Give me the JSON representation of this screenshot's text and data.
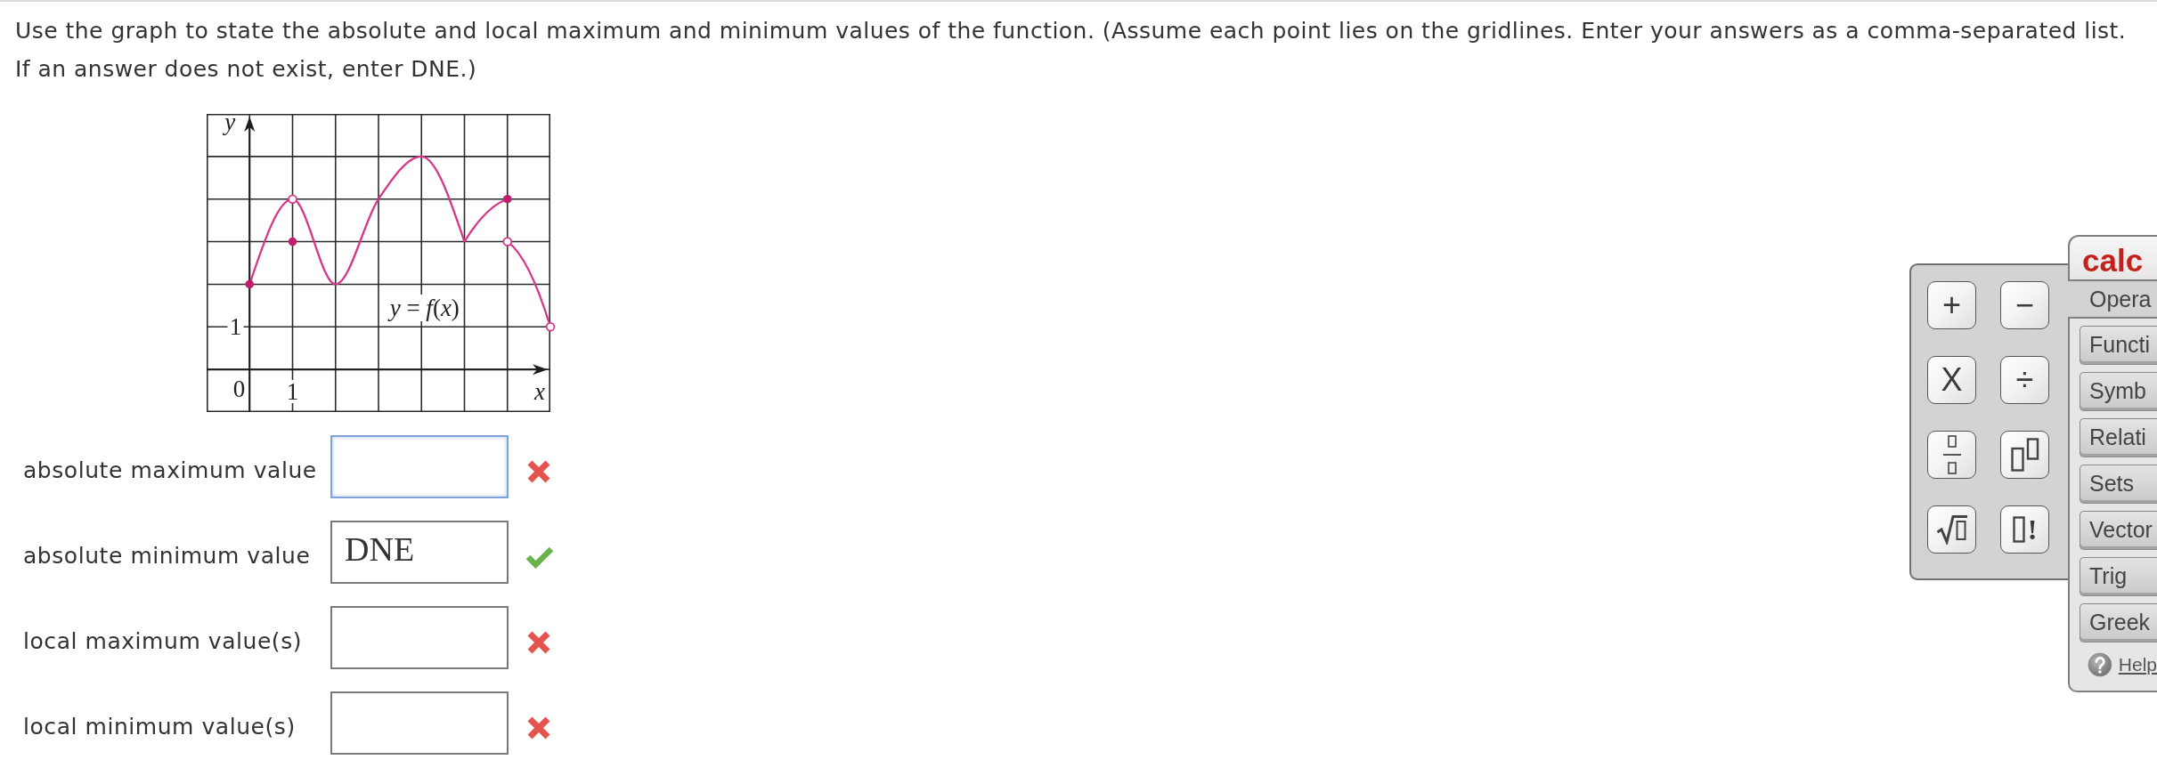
{
  "question": {
    "prompt": "Use the graph to state the absolute and local maximum and minimum values of the function. (Assume each point lies on the gridlines. Enter your answers as a comma-separated list. If an answer does not exist, enter DNE.)"
  },
  "graph": {
    "y_axis_label": "y",
    "x_axis_label": "x",
    "origin_label": "0",
    "x_tick_label": "1",
    "y_tick_label": "1",
    "curve_label": "*y* = *f*(*x*)"
  },
  "answers": [
    {
      "label": "absolute maximum value",
      "focused": true,
      "correct": false
    },
    {
      "label": "absolute minimum value",
      "value": "DNE",
      "focused": false,
      "correct": true
    },
    {
      "label": "local maximum value(s)",
      "focused": false,
      "correct": false
    },
    {
      "label": "local minimum value(s)",
      "focused": false,
      "correct": false
    }
  ],
  "calc_pad": {
    "title": "calc",
    "keys": [
      {
        "kind": "symbol",
        "label": "+"
      },
      {
        "kind": "symbol",
        "label": "−"
      },
      {
        "kind": "symbol",
        "label": "X"
      },
      {
        "kind": "symbol",
        "label": "÷"
      },
      {
        "kind": "fraction"
      },
      {
        "kind": "power"
      },
      {
        "kind": "root"
      },
      {
        "kind": "factorial",
        "label": "!"
      }
    ],
    "categories": [
      {
        "label": "Opera",
        "selected": true
      },
      {
        "label": "Functi",
        "selected": false
      },
      {
        "label": "Symb",
        "selected": false
      },
      {
        "label": "Relati",
        "selected": false
      },
      {
        "label": "Sets",
        "selected": false
      },
      {
        "label": "Vector",
        "selected": false
      },
      {
        "label": "Trig",
        "selected": false
      },
      {
        "label": "Greek",
        "selected": false
      }
    ],
    "help": "Help"
  }
}
